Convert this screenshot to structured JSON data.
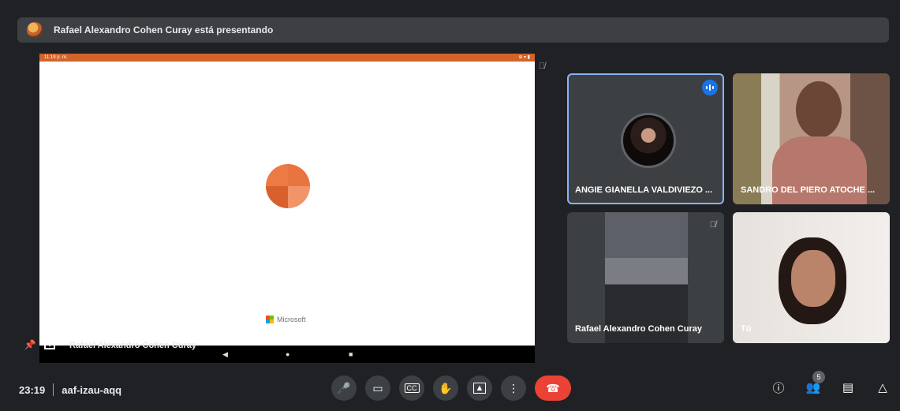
{
  "header": {
    "presenting_text": "Rafael Alexandro Cohen Curay está presentando"
  },
  "presentation": {
    "status_time": "11:19 p. m.",
    "status_right": "⊕ ▾ ▮",
    "logo_text": "Microsoft",
    "presenter_label": "Rafael Alexandro Cohen Curay"
  },
  "tiles": [
    {
      "name": "ANGIE GIANELLA VALDIVIEZO ...",
      "speaking": true
    },
    {
      "name": "SANDRO DEL PIERO ATOCHE ..."
    },
    {
      "name": "Rafael Alexandro Cohen Curay",
      "muted": true
    },
    {
      "name": "Tú"
    }
  ],
  "meeting": {
    "time": "23:19",
    "code": "aaf-izau-aqq"
  },
  "controls": {
    "participants_count": "5"
  },
  "colors": {
    "accent": "#1a73e8",
    "end_call": "#ea4335",
    "tile_bg": "#3c4043",
    "background": "#202124"
  },
  "icons": [
    "mic-icon",
    "camera-icon",
    "captions-icon",
    "raise-hand-icon",
    "present-icon",
    "more-options-icon",
    "end-call-icon",
    "info-icon",
    "people-icon",
    "chat-icon",
    "activities-icon"
  ]
}
